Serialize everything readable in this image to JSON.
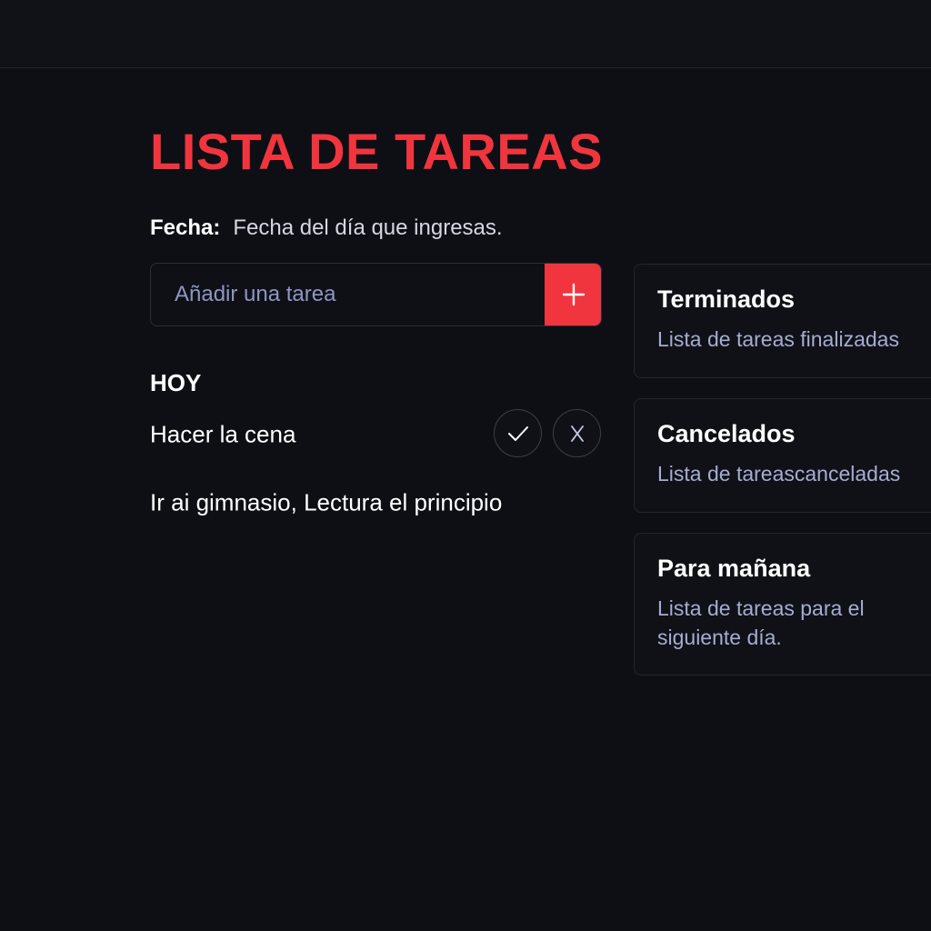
{
  "title": "LISTA DE TAREAS",
  "date": {
    "label": "Fecha:",
    "value": "Fecha del día que ingresas."
  },
  "add_task": {
    "placeholder": "Añadir una tarea",
    "button_icon": "plus-icon"
  },
  "today": {
    "heading": "HOY",
    "tasks": [
      {
        "text": "Hacer la cena",
        "actions": [
          "check-icon",
          "x-icon"
        ]
      },
      {
        "text": "Ir ai gimnasio, Lectura el principio"
      }
    ]
  },
  "cards": [
    {
      "title": "Terminados",
      "description": "Lista de tareas finalizadas"
    },
    {
      "title": "Cancelados",
      "description": "Lista de tareascanceladas"
    },
    {
      "title": "Para mañana",
      "description": "Lista de tareas para el siguiente día."
    }
  ],
  "colors": {
    "background": "#0d0f14",
    "accent": "#f0353f",
    "muted_text": "#a6acd0",
    "placeholder": "#8f96c2"
  }
}
